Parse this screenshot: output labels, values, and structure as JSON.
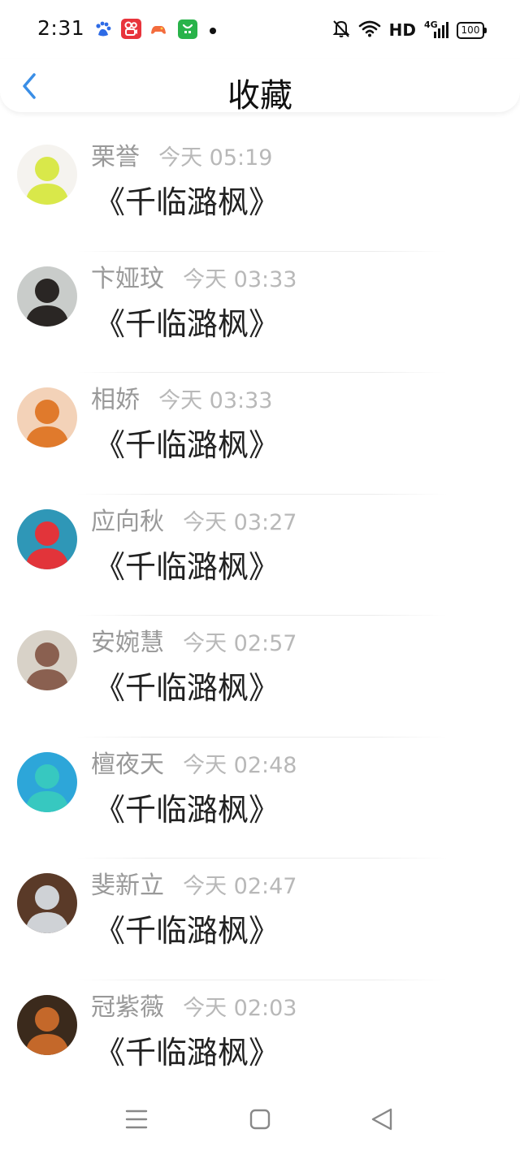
{
  "status_bar": {
    "time": "2:31",
    "network": "HD",
    "signal": "4G",
    "battery": "100"
  },
  "header": {
    "title": "收藏"
  },
  "favorites": [
    {
      "name": "栗誉",
      "time": "今天 05:19",
      "title": "《千临潞枫》",
      "avatar_colors": [
        "#f5f3ef",
        "#d9e84a"
      ]
    },
    {
      "name": "卞娅玟",
      "time": "今天 03:33",
      "title": "《千临潞枫》",
      "avatar_colors": [
        "#c9ccca",
        "#2a2624"
      ]
    },
    {
      "name": "相娇",
      "time": "今天 03:33",
      "title": "《千临潞枫》",
      "avatar_colors": [
        "#f3d2b8",
        "#e07a2c"
      ]
    },
    {
      "name": "应向秋",
      "time": "今天 03:27",
      "title": "《千临潞枫》",
      "avatar_colors": [
        "#2f97b7",
        "#e2343a"
      ]
    },
    {
      "name": "安婉慧",
      "time": "今天 02:57",
      "title": "《千临潞枫》",
      "avatar_colors": [
        "#d8d2c8",
        "#8a6050"
      ]
    },
    {
      "name": "檀夜天",
      "time": "今天 02:48",
      "title": "《千临潞枫》",
      "avatar_colors": [
        "#2da6d9",
        "#37c8c0"
      ]
    },
    {
      "name": "斐新立",
      "time": "今天 02:47",
      "title": "《千临潞枫》",
      "avatar_colors": [
        "#5a3a28",
        "#cfd2d6"
      ]
    },
    {
      "name": "冠紫薇",
      "time": "今天 02:03",
      "title": "《千临潞枫》",
      "avatar_colors": [
        "#3b2a1c",
        "#c4682a"
      ]
    }
  ],
  "colors": {
    "accent": "#3a8ee6",
    "name": "#999999",
    "time": "#b8b8b8",
    "title": "#222222"
  }
}
